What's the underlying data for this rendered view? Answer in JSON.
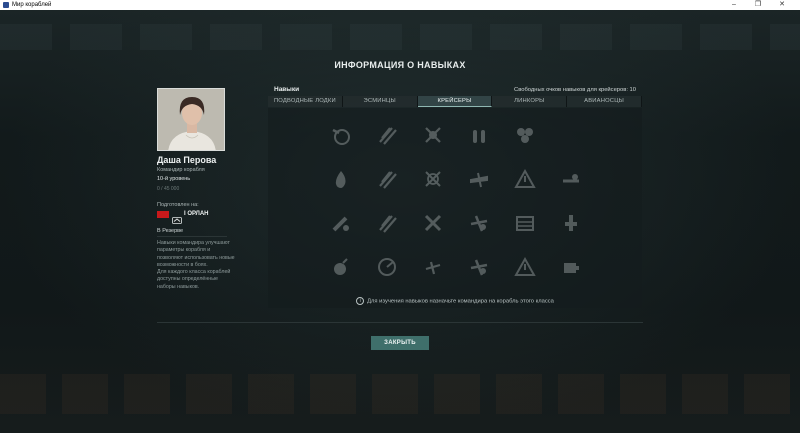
{
  "window": {
    "title": "Мир кораблей"
  },
  "dialog": {
    "title": "ИНФОРМАЦИЯ О НАВЫКАХ"
  },
  "commander": {
    "name": "Даша Перова",
    "role": "Командир корабля",
    "level": "10-й уровень",
    "xp": "0 / 45 000",
    "trained_label": "Подготовлен на:",
    "ship_name": "I ОРЛАН",
    "status": "В Резерве",
    "description_1": "Навыки командира улучшают параметры корабля и позволяют использовать новые возможности в боях.",
    "description_2": "Для каждого класса кораблей доступны определённые наборы навыков."
  },
  "skills": {
    "title": "Навыки",
    "free_points": "Свободных очков навыков для крейсеров: 10",
    "tabs": [
      {
        "label": "ПОДВОДНЫЕ ЛОДКИ",
        "active": false
      },
      {
        "label": "ЭСМИНЦЫ",
        "active": false
      },
      {
        "label": "КРЕЙСЕРЫ",
        "active": true
      },
      {
        "label": "ЛИНКОРЫ",
        "active": false
      },
      {
        "label": "АВИАНОСЦЫ",
        "active": false
      }
    ],
    "icons": [
      "spyglass-icon",
      "shells-slash-icon",
      "crosshair-icon",
      "shells-icon",
      "gear-cluster-icon",
      "",
      "fire-icon",
      "shells-slash-icon",
      "target-icon",
      "plane-icon",
      "warning-icon",
      "radar-icon",
      "torpedo-icon",
      "shells-slash-icon",
      "wrench-icon",
      "plane-slash-icon",
      "ammo-box-icon",
      "repair-icon",
      "bomb-icon",
      "radar-scope-icon",
      "plane-small-icon",
      "plane-slash-icon",
      "warning-icon",
      "engine-icon"
    ],
    "note": "Для изучения навыков назначьте командира на корабль этого класса"
  },
  "actions": {
    "close_label": "ЗАКРЫТЬ"
  },
  "colors": {
    "accent": "#3f6f6b",
    "flag": "#c8191b"
  }
}
